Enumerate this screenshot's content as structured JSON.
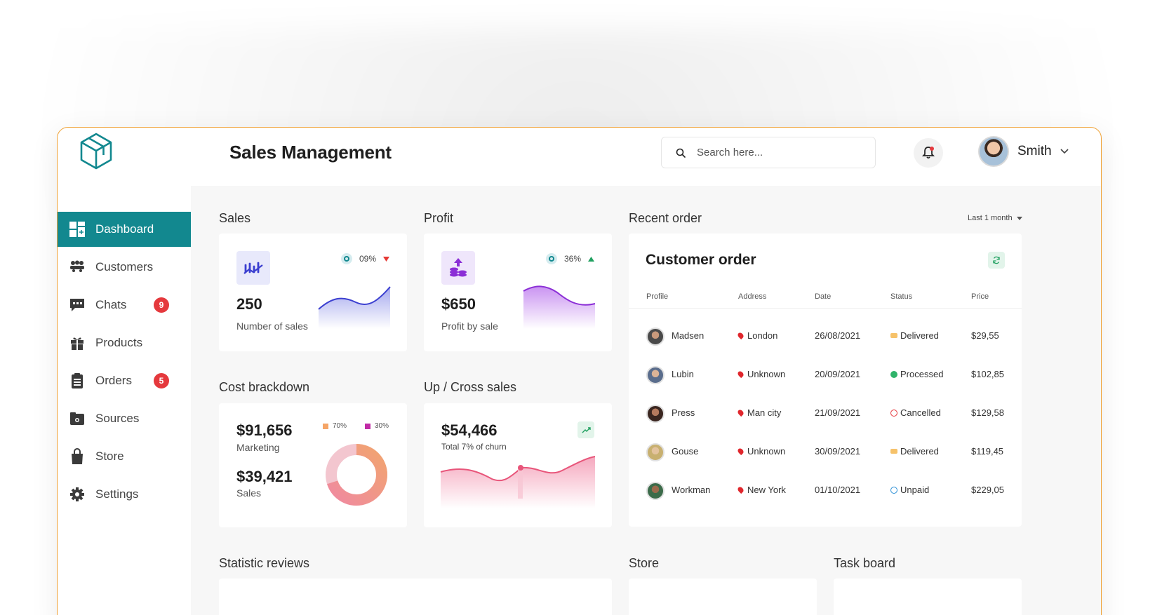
{
  "header": {
    "title": "Sales Management",
    "search_placeholder": "Search here...",
    "user_name": "Smith"
  },
  "sidebar": {
    "items": [
      {
        "label": "Dashboard",
        "active": true
      },
      {
        "label": "Customers"
      },
      {
        "label": "Chats",
        "badge": "9"
      },
      {
        "label": "Products"
      },
      {
        "label": "Orders",
        "badge": "5"
      },
      {
        "label": "Sources"
      },
      {
        "label": "Store"
      },
      {
        "label": "Settings"
      }
    ]
  },
  "sales": {
    "section": "Sales",
    "value": "250",
    "label": "Number of sales",
    "change": "09%",
    "trend": "down"
  },
  "profit": {
    "section": "Profit",
    "value": "$650",
    "label": "Profit by sale",
    "change": "36%",
    "trend": "up"
  },
  "cost": {
    "section": "Cost brackdown",
    "marketing_value": "$91,656",
    "marketing_label": "Marketing",
    "sales_value": "$39,421",
    "sales_label": "Sales",
    "legend_a": "70%",
    "legend_b": "30%",
    "share_a": 0.7,
    "share_b": 0.3
  },
  "cross": {
    "section": "Up / Cross sales",
    "value": "$54,466",
    "label": "Total 7% of churn"
  },
  "recent": {
    "section": "Recent order",
    "filter": "Last 1 month",
    "card_title": "Customer order",
    "columns": [
      "Profile",
      "Address",
      "Date",
      "Status",
      "Price"
    ],
    "rows": [
      {
        "name": "Madsen",
        "address": "London",
        "date": "26/08/2021",
        "status": "Delivered",
        "price": "$29,55"
      },
      {
        "name": "Lubin",
        "address": "Unknown",
        "date": "20/09/2021",
        "status": "Processed",
        "price": "$102,85"
      },
      {
        "name": "Press",
        "address": "Man city",
        "date": "21/09/2021",
        "status": "Cancelled",
        "price": "$129,58"
      },
      {
        "name": "Gouse",
        "address": "Unknown",
        "date": "30/09/2021",
        "status": "Delivered",
        "price": "$119,45"
      },
      {
        "name": "Workman",
        "address": "New York",
        "date": "01/10/2021",
        "status": "Unpaid",
        "price": "$229,05"
      }
    ]
  },
  "bottom": {
    "statistic": "Statistic reviews",
    "store": "Store",
    "task": "Task board"
  },
  "colors": {
    "accent": "#12888f",
    "badge": "#e5393d",
    "frame": "#f0a43a"
  }
}
